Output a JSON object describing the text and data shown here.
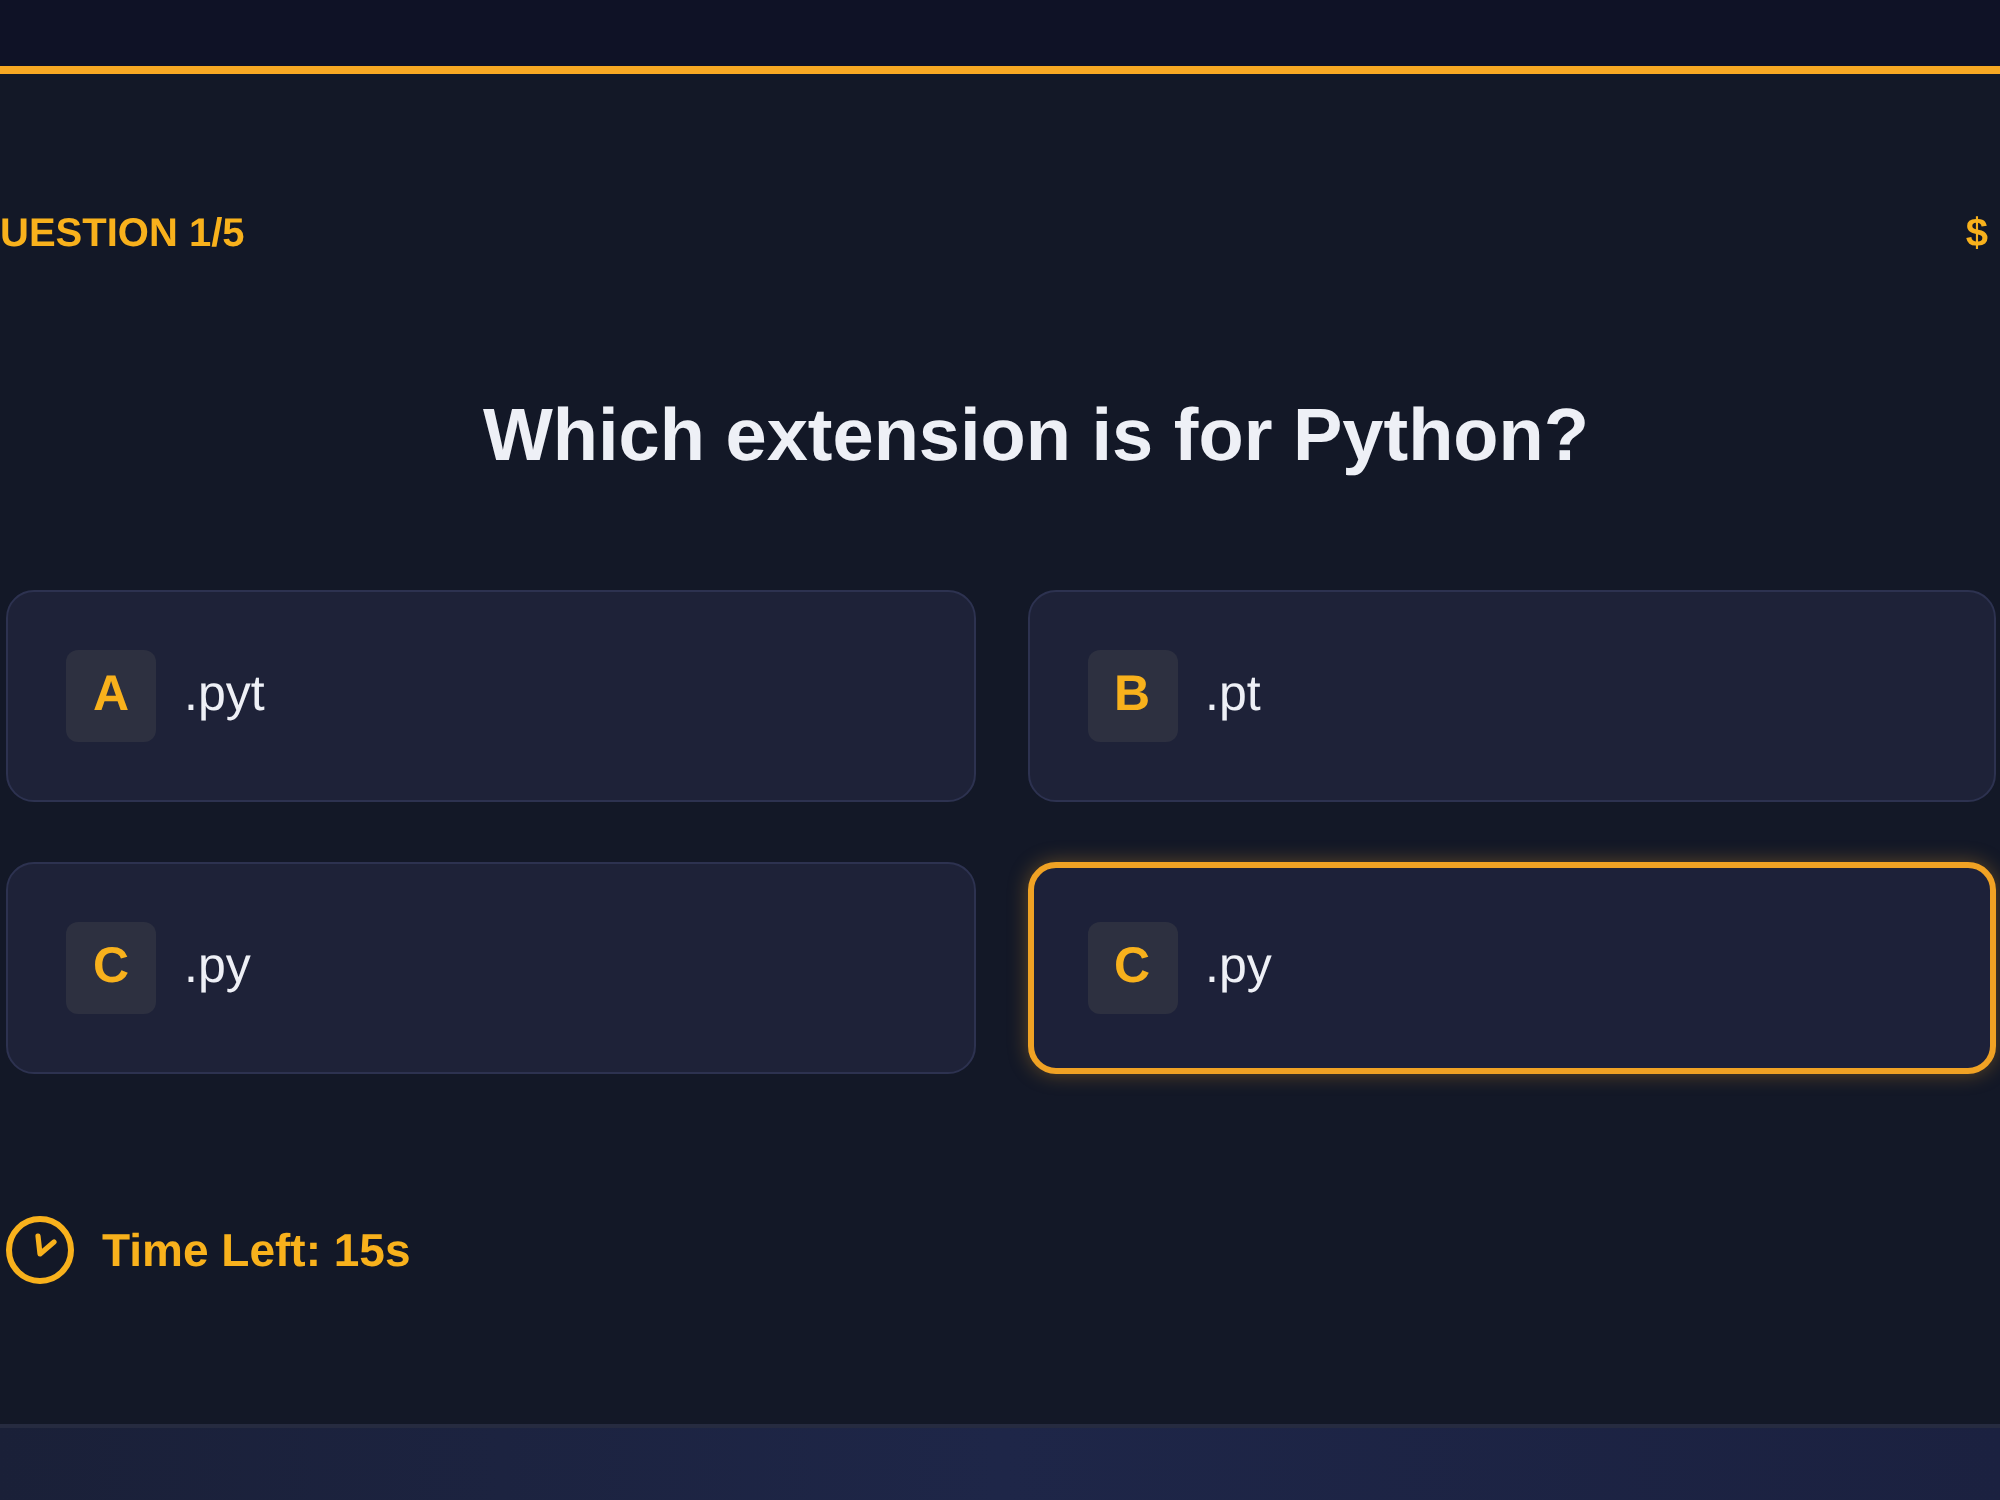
{
  "header": {
    "question_counter": "UESTION 1/5",
    "score": "$"
  },
  "question": "Which extension is for Python?",
  "options": [
    {
      "letter": "A",
      "text": ".pyt",
      "selected": false
    },
    {
      "letter": "B",
      "text": ".pt",
      "selected": false
    },
    {
      "letter": "C",
      "text": ".py",
      "selected": false
    },
    {
      "letter": "C",
      "text": ".py",
      "selected": true
    }
  ],
  "timer": {
    "label": "Time Left: 15s"
  }
}
